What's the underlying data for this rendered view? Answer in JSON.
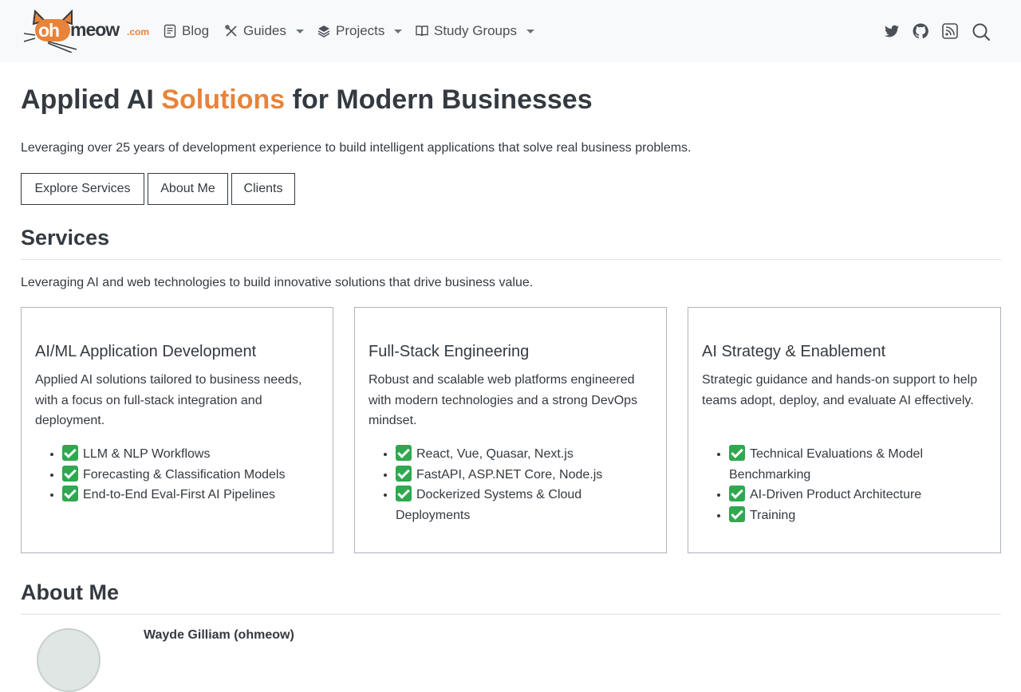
{
  "nav": {
    "logo": {
      "badge": "oh",
      "text": "meow",
      "suffix": ".com"
    },
    "items": [
      {
        "label": "Blog",
        "icon": "document-icon",
        "has_dropdown": false
      },
      {
        "label": "Guides",
        "icon": "tools-icon",
        "has_dropdown": true
      },
      {
        "label": "Projects",
        "icon": "layers-icon",
        "has_dropdown": true
      },
      {
        "label": "Study Groups",
        "icon": "book-icon",
        "has_dropdown": true
      }
    ],
    "right_icons": [
      "twitter-icon",
      "github-icon",
      "rss-icon",
      "search-icon"
    ]
  },
  "hero": {
    "title_before": "Applied AI ",
    "title_accent": "Solutions",
    "title_after": " for Modern Businesses",
    "subtitle": "Leveraging over 25 years of development experience to build intelligent applications that solve real business problems.",
    "buttons": [
      "Explore Services",
      "About Me",
      "Clients"
    ]
  },
  "services": {
    "title": "Services",
    "subtitle": "Leveraging AI and web technologies to build innovative solutions that drive business value.",
    "cards": [
      {
        "title": "AI/ML Application Development",
        "description": "Applied AI solutions tailored to business needs, with a focus on full-stack integration and deployment.",
        "items": [
          "LLM & NLP Workflows",
          "Forecasting & Classification Models",
          "End-to-End Eval-First AI Pipelines"
        ]
      },
      {
        "title": "Full-Stack Engineering",
        "description": "Robust and scalable web platforms engineered with modern technologies and a strong DevOps mindset.",
        "items": [
          "React, Vue, Quasar, Next.js",
          "FastAPI, ASP.NET Core, Node.js",
          "Dockerized Systems & Cloud Deployments"
        ]
      },
      {
        "title": "AI Strategy & Enablement",
        "description": "Strategic guidance and hands-on support to help teams adopt, deploy, and evaluate AI effectively.",
        "items": [
          "Technical Evaluations & Model Benchmarking",
          "AI-Driven Product Architecture",
          "Training"
        ]
      }
    ]
  },
  "about": {
    "title": "About Me",
    "name": "Wayde Gilliam (ohmeow)"
  },
  "colors": {
    "accent": "#e8833a",
    "text": "#343a40",
    "navbar_bg": "#f8f9fa",
    "check": "#2fa84f"
  }
}
